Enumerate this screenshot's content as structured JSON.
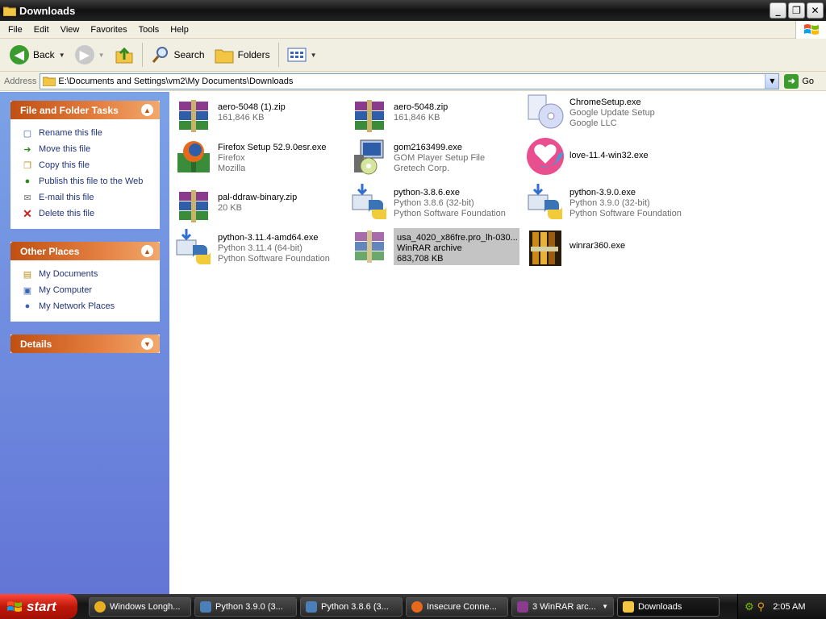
{
  "window": {
    "title": "Downloads",
    "controls": [
      "_",
      "❐",
      "✕"
    ]
  },
  "menu": [
    "File",
    "Edit",
    "View",
    "Favorites",
    "Tools",
    "Help"
  ],
  "toolbar": {
    "back_label": "Back",
    "search_label": "Search",
    "folders_label": "Folders"
  },
  "address": {
    "label": "Address",
    "path": "E:\\Documents and Settings\\vm2\\My Documents\\Downloads",
    "go_label": "Go"
  },
  "sidebar": {
    "tasks": {
      "title": "File and Folder Tasks",
      "items": [
        {
          "label": "Rename this file",
          "icon": "rename-icon"
        },
        {
          "label": "Move this file",
          "icon": "move-icon"
        },
        {
          "label": "Copy this file",
          "icon": "copy-icon"
        },
        {
          "label": "Publish this file to the Web",
          "icon": "globe-icon"
        },
        {
          "label": "E-mail this file",
          "icon": "email-icon"
        },
        {
          "label": "Delete this file",
          "icon": "delete-icon"
        }
      ]
    },
    "places": {
      "title": "Other Places",
      "items": [
        {
          "label": "My Documents",
          "icon": "my-documents-icon"
        },
        {
          "label": "My Computer",
          "icon": "my-computer-icon"
        },
        {
          "label": "My Network Places",
          "icon": "network-icon"
        }
      ]
    },
    "details": {
      "title": "Details"
    }
  },
  "files": [
    {
      "name": "aero-5048 (1).zip",
      "line2": "161,846 KB",
      "line3": "",
      "icon": "winrar-archive-icon"
    },
    {
      "name": "aero-5048.zip",
      "line2": "161,846 KB",
      "line3": "",
      "icon": "winrar-archive-icon"
    },
    {
      "name": "ChromeSetup.exe",
      "line2": "Google Update Setup",
      "line3": "Google LLC",
      "icon": "installer-cd-icon"
    },
    {
      "name": "Firefox Setup 52.9.0esr.exe",
      "line2": "Firefox",
      "line3": "Mozilla",
      "icon": "firefox-installer-icon"
    },
    {
      "name": "gom2163499.exe",
      "line2": "GOM Player Setup File",
      "line3": "Gretech Corp.",
      "icon": "setup-computer-icon"
    },
    {
      "name": "love-11.4-win32.exe",
      "line2": "",
      "line3": "",
      "icon": "love-heart-icon"
    },
    {
      "name": "pal-ddraw-binary.zip",
      "line2": "20 KB",
      "line3": "",
      "icon": "winrar-archive-icon"
    },
    {
      "name": "python-3.8.6.exe",
      "line2": "Python 3.8.6 (32-bit)",
      "line3": "Python Software Foundation",
      "icon": "python-installer-icon"
    },
    {
      "name": "python-3.9.0.exe",
      "line2": "Python 3.9.0 (32-bit)",
      "line3": "Python Software Foundation",
      "icon": "python-installer-icon"
    },
    {
      "name": "python-3.11.4-amd64.exe",
      "line2": "Python 3.11.4 (64-bit)",
      "line3": "Python Software Foundation",
      "icon": "python-installer-icon"
    },
    {
      "name": "usa_4020_x86fre.pro_lh-030...",
      "line2": "WinRAR archive",
      "line3": "683,708 KB",
      "icon": "winrar-archive-icon",
      "selected": true
    },
    {
      "name": "winrar360.exe",
      "line2": "",
      "line3": "",
      "icon": "winrar-books-icon"
    }
  ],
  "taskbar": {
    "start_label": "start",
    "items": [
      {
        "label": "Windows Longh...",
        "icon": "chrome-icon",
        "color": "#e8b021"
      },
      {
        "label": "Python 3.9.0 (3...",
        "icon": "python-setup-icon",
        "color": "#4b7fb8"
      },
      {
        "label": "Python 3.8.6 (3...",
        "icon": "python-setup-icon",
        "color": "#4b7fb8"
      },
      {
        "label": "Insecure Conne...",
        "icon": "firefox-icon",
        "color": "#e66a1b"
      },
      {
        "label": "3 WinRAR arc...",
        "icon": "winrar-icon",
        "color": "#8a3b8e"
      },
      {
        "label": "Downloads",
        "icon": "folder-icon",
        "color": "#f3c544",
        "active": true
      }
    ],
    "clock": "2:05 AM"
  },
  "colors": {
    "sidepanel": "#7ba2e7",
    "task_header": "#e48041",
    "link": "#21347b",
    "selection": "#c4c4c4"
  }
}
